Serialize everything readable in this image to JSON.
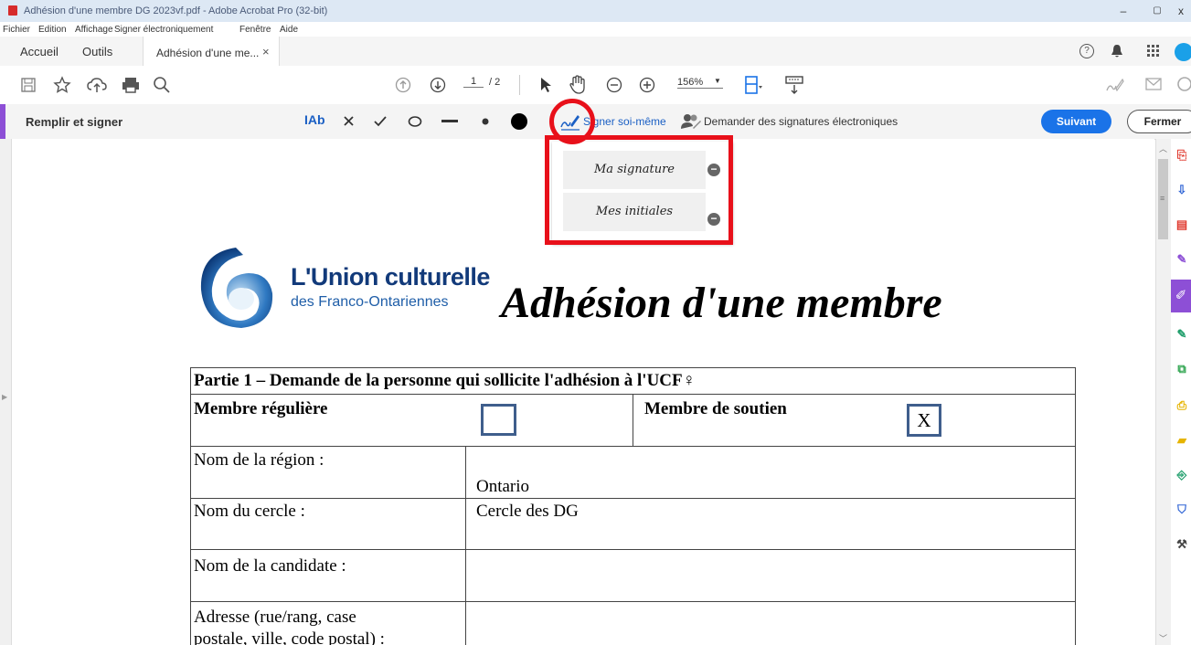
{
  "window": {
    "title": "Adhésion d'une membre DG 2023vf.pdf - Adobe Acrobat Pro (32-bit)",
    "controls": [
      "–",
      "▢",
      "x"
    ]
  },
  "menu": [
    "Fichier",
    "Edition",
    "Affichage",
    "Signer électroniquement",
    "Fenêtre",
    "Aide"
  ],
  "tabs": {
    "home": "Accueil",
    "tools": "Outils",
    "document": "Adhésion d'une me...",
    "close": "×"
  },
  "toolbar": {
    "page_current": "1",
    "page_total": "/ 2",
    "zoom": "156%"
  },
  "fillsign": {
    "title": "Remplir et signer",
    "text_tool": "IAb",
    "sign_self": "Signer soi-même",
    "request_sign": "Demander des signatures électroniques",
    "next": "Suivant",
    "close": "Fermer"
  },
  "popup": {
    "signature": "Ma signature",
    "initials": "Mes initiales"
  },
  "document": {
    "logo_line1": "L'Union culturelle",
    "logo_line2": "des Franco-Ontariennes",
    "heading": "Adhésion d'une membre",
    "part1": "Partie 1 – Demande de la personne qui sollicite l'adhésion à l'UCF♀",
    "regular": "Membre régulière",
    "support": "Membre de soutien",
    "support_mark": "X",
    "rows": [
      {
        "label": "Nom de la région :",
        "value": "Ontario"
      },
      {
        "label": "Nom du cercle :",
        "value": "Cercle des DG"
      },
      {
        "label": "Nom de la candidate :",
        "value": ""
      },
      {
        "label": "Adresse (rue/rang, case",
        "label2": "postale, ville, code postal) :",
        "value": ""
      }
    ]
  },
  "colors": {
    "accent_purple": "#8d4fd6",
    "primary_blue": "#1a73e8",
    "annotation_red": "#e8101a",
    "checkbox_blue": "#3f5e8c"
  }
}
